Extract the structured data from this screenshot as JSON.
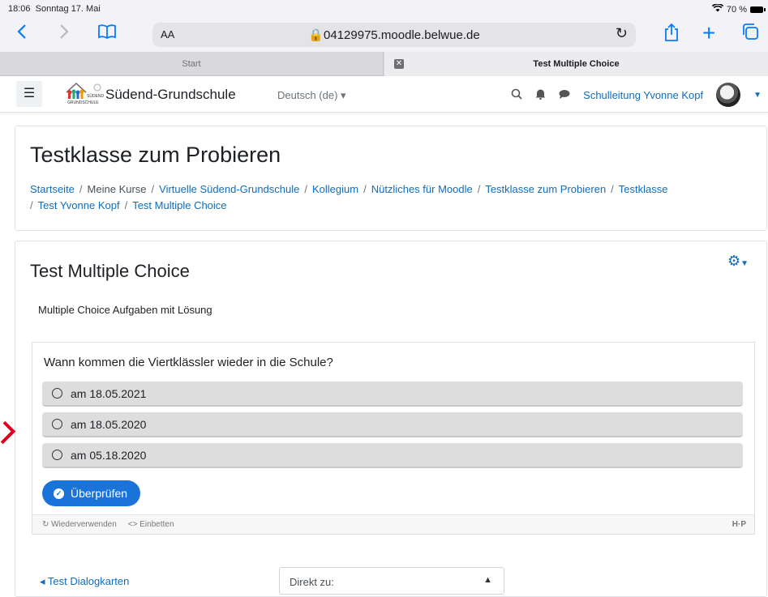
{
  "status": {
    "time": "18:06",
    "date": "Sonntag 17. Mai",
    "battery": "70 %"
  },
  "safari": {
    "aa": "AA",
    "url": "04129975.moodle.belwue.de"
  },
  "tabs": [
    {
      "label": "Start"
    },
    {
      "label": "Test Multiple Choice"
    }
  ],
  "nav": {
    "site_name": "Südend-Grundschule",
    "language": "Deutsch (de) ▾",
    "user": "Schulleitung Yvonne Kopf",
    "logo_text": "SÜDEND GRUNDSCHULE"
  },
  "course": {
    "title": "Testklasse zum Probieren",
    "breadcrumb": [
      "Startseite",
      "Meine Kurse",
      "Virtuelle Südend-Grundschule",
      "Kollegium",
      "Nützliches für Moodle",
      "Testklasse zum Probieren",
      "Testklasse",
      "Test Yvonne Kopf",
      "Test Multiple Choice"
    ]
  },
  "activity": {
    "title": "Test Multiple Choice",
    "intro": "Multiple Choice Aufgaben mit Lösung",
    "question": "Wann kommen die Viertklässler wieder in die Schule?",
    "options": [
      "am 18.05.2021",
      "am 18.05.2020",
      "am 05.18.2020"
    ],
    "check_label": "Überprüfen",
    "footer": {
      "reuse": "Wiederverwenden",
      "embed": "Einbetten",
      "brand": "H·P"
    }
  },
  "navigation": {
    "prev": "◂ Test Dialogkarten",
    "jump": "Direkt zu:"
  },
  "colors": {
    "link": "#0f6cbf",
    "button": "#1a73d9",
    "ios_blue": "#0a7aff"
  },
  "icons": [
    "wifi-icon",
    "back-icon",
    "forward-icon",
    "bookmarks-icon",
    "reload-icon",
    "share-icon",
    "new-tab-icon",
    "tabs-icon",
    "menu-icon",
    "search-icon",
    "bell-icon",
    "chat-icon",
    "gear-icon"
  ]
}
